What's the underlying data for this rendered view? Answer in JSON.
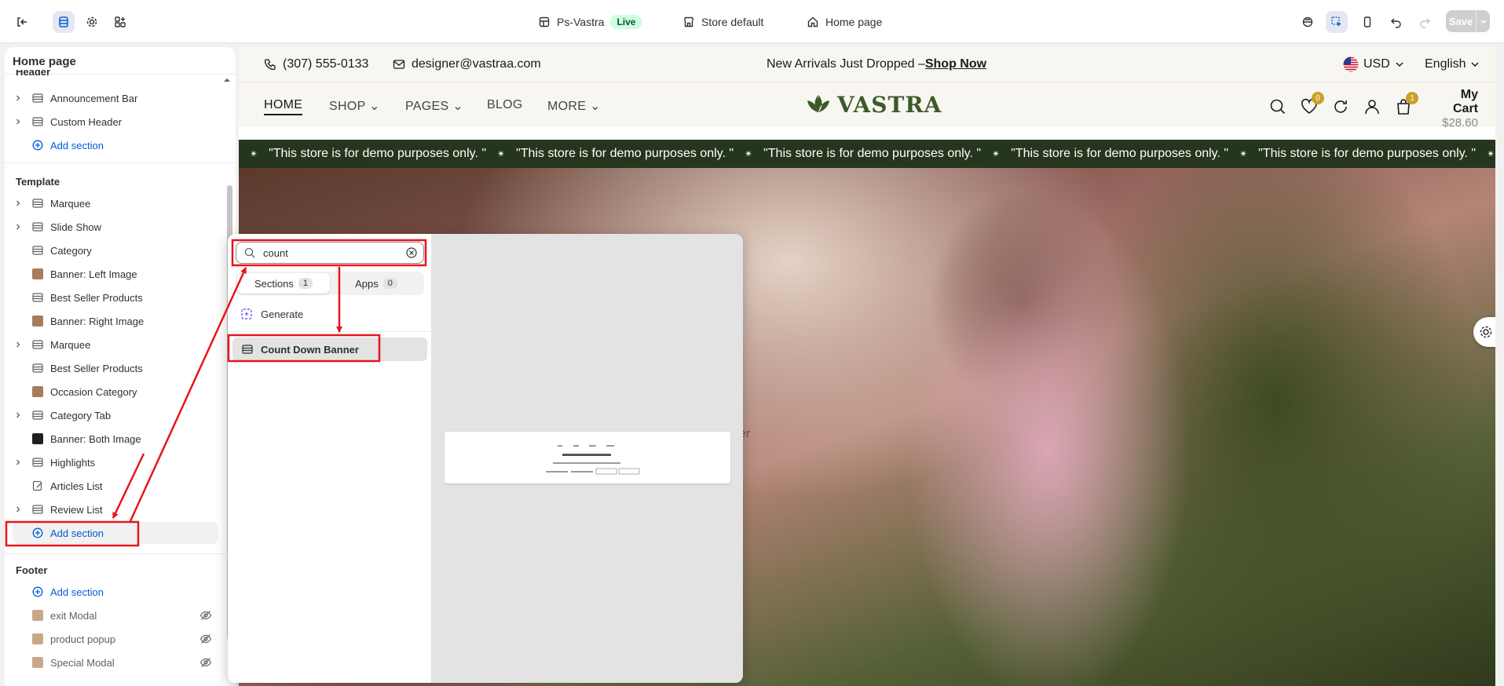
{
  "topbar": {
    "store_name": "Ps-Vastra",
    "live_badge": "Live",
    "theme": "Store default",
    "page": "Home page",
    "save_label": "Save"
  },
  "sidebar": {
    "title": "Home page",
    "header_group": {
      "title": "Header",
      "items": [
        {
          "label": "Announcement Bar",
          "icon": "section-icon",
          "expandable": true
        },
        {
          "label": "Custom Header",
          "icon": "section-icon",
          "expandable": true
        }
      ],
      "add_section": "Add section"
    },
    "template_group": {
      "title": "Template",
      "items": [
        {
          "label": "Marquee",
          "icon": "section-icon",
          "expandable": true
        },
        {
          "label": "Slide Show",
          "icon": "section-icon",
          "expandable": true
        },
        {
          "label": "Category",
          "icon": "section-icon",
          "expandable": false
        },
        {
          "label": "Banner: Left Image",
          "icon": "image-thumb",
          "expandable": false
        },
        {
          "label": "Best Seller Products",
          "icon": "section-icon",
          "expandable": false
        },
        {
          "label": "Banner: Right Image",
          "icon": "image-thumb",
          "expandable": false
        },
        {
          "label": "Marquee",
          "icon": "section-icon",
          "expandable": true
        },
        {
          "label": "Best Seller Products",
          "icon": "section-icon",
          "expandable": false
        },
        {
          "label": "Occasion Category",
          "icon": "image-thumb",
          "expandable": false
        },
        {
          "label": "Category Tab",
          "icon": "section-icon",
          "expandable": true
        },
        {
          "label": "Banner: Both Image",
          "icon": "image-thumb-dark",
          "expandable": false
        },
        {
          "label": "Highlights",
          "icon": "section-icon",
          "expandable": true
        },
        {
          "label": "Articles List",
          "icon": "edit-icon",
          "expandable": false
        },
        {
          "label": "Review List",
          "icon": "section-icon",
          "expandable": true
        }
      ],
      "add_section": "Add section"
    },
    "footer_group": {
      "title": "Footer",
      "add_section": "Add section",
      "items": [
        {
          "label": "exit Modal",
          "hidden": true
        },
        {
          "label": "product popup",
          "hidden": true
        },
        {
          "label": "Special Modal",
          "hidden": true
        }
      ]
    }
  },
  "popover": {
    "search_value": "count",
    "tabs": [
      {
        "label": "Sections",
        "count": "1"
      },
      {
        "label": "Apps",
        "count": "0"
      }
    ],
    "generate_label": "Generate",
    "result_label": "Count Down Banner"
  },
  "preview": {
    "phone": "(307) 555-0133",
    "email": "designer@vastraa.com",
    "promo_text": "New Arrivals Just Dropped –",
    "promo_link": "Shop Now",
    "currency": "USD",
    "language": "English",
    "nav": [
      "HOME",
      "SHOP",
      "PAGES",
      "BLOG",
      "MORE"
    ],
    "logo": "VASTRA",
    "wishlist_count": "0",
    "cart_count": "1",
    "cart_label": "My Cart",
    "cart_total": "$28.60",
    "marquee_text": "\"This store is for demo purposes only. \""
  },
  "colors": {
    "accent_blue": "#005bd3",
    "annotation_red": "#e8141c",
    "marquee_bg": "#26361e",
    "live_green": "#cdfee1",
    "badge_gold": "#c9a227"
  }
}
